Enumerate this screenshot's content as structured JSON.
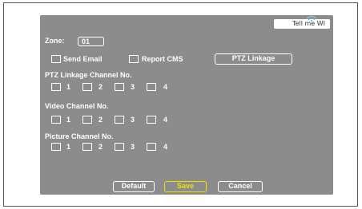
{
  "brand": {
    "logo_text": "Tell me WI"
  },
  "zone": {
    "label": "Zone:",
    "value": "01"
  },
  "actions": {
    "send_email": "Send Email",
    "report_cms": "Report CMS",
    "ptz_linkage_button": "PTZ Linkage"
  },
  "sections": {
    "ptz_channel": {
      "title": "PTZ Linkage Channel No.",
      "channels": [
        "1",
        "2",
        "3",
        "4"
      ]
    },
    "video_channel": {
      "title": "Video Channel No.",
      "channels": [
        "1",
        "2",
        "3",
        "4"
      ]
    },
    "picture_channel": {
      "title": "Picture Channel No.",
      "channels": [
        "1",
        "2",
        "3",
        "4"
      ]
    }
  },
  "footer": {
    "default_label": "Default",
    "save_label": "Save",
    "cancel_label": "Cancel"
  },
  "colors": {
    "panel_bg": "#8c8c8c",
    "text": "#ffffff",
    "selected": "#f2e000"
  },
  "icons": {
    "logo_wifi": "wifi-icon"
  }
}
